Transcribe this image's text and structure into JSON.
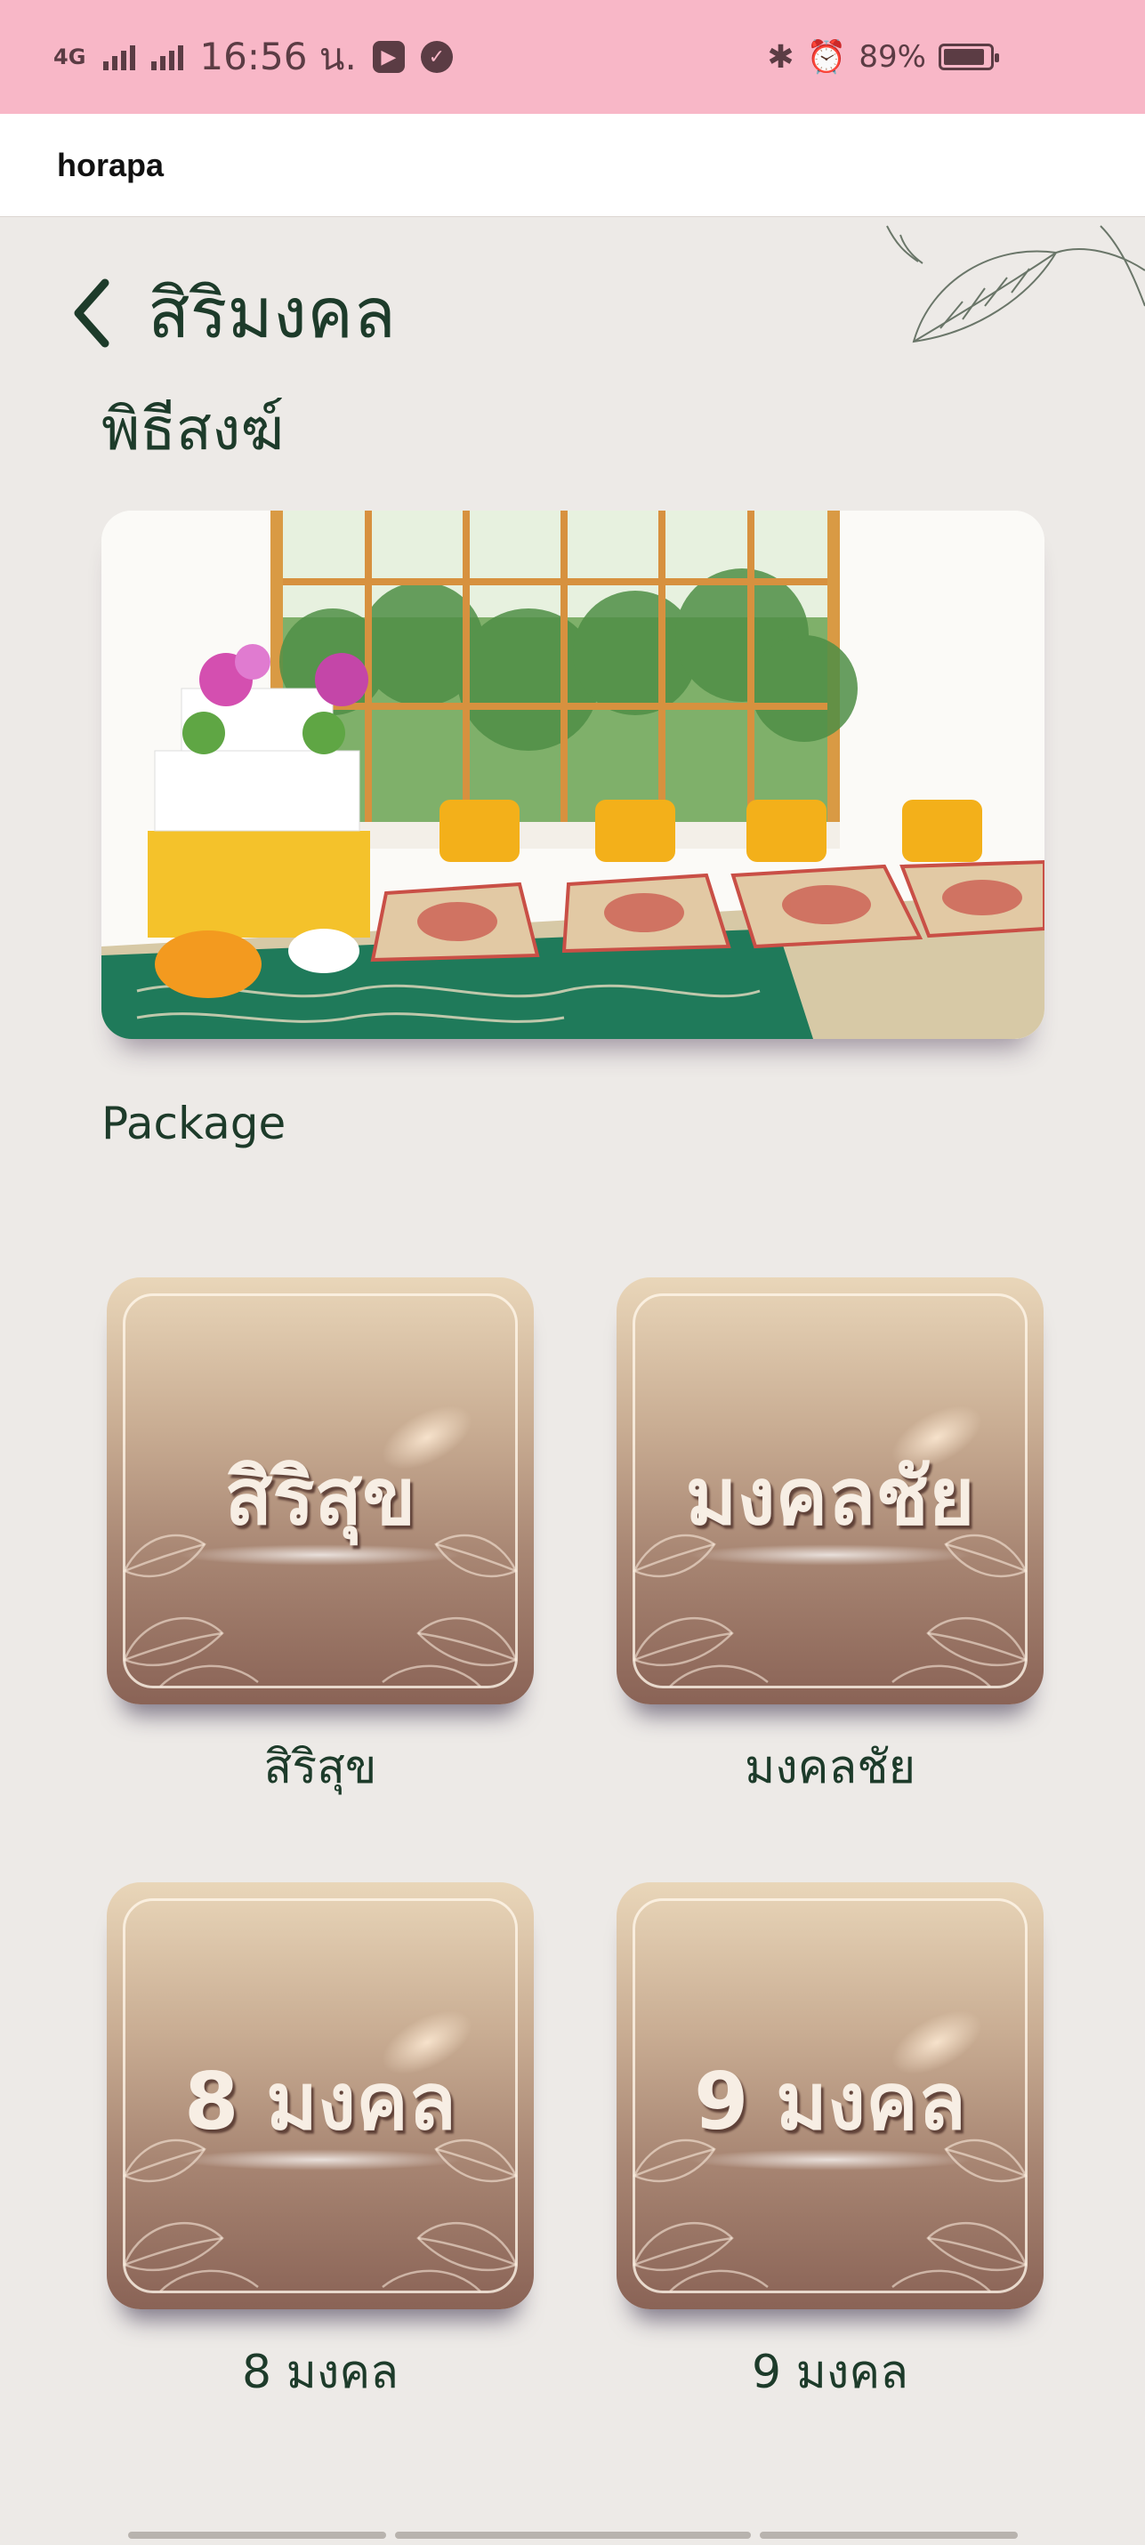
{
  "status_bar": {
    "network_left": "4G",
    "time": "16:56 น.",
    "battery": "89%",
    "battery_level": 0.89
  },
  "app_bar": {
    "title": "horapa"
  },
  "header": {
    "title": "สิริมงคล",
    "section": "พิธีสงฆ์"
  },
  "hero": {
    "icon": "ceremony-room-photo"
  },
  "package": {
    "label": "Package",
    "items": [
      {
        "tile_text": "สิริสุข",
        "caption": "สิริสุข"
      },
      {
        "tile_text": "มงคลชัย",
        "caption": "มงคลชัย"
      },
      {
        "tile_text": "8 มงคล",
        "caption": "8 มงคล"
      },
      {
        "tile_text": "9 มงคล",
        "caption": "9 มงคล"
      }
    ]
  },
  "colors": {
    "status_bar": "#f8b7c7",
    "background": "#edeae7",
    "title_text": "#1d3b2a",
    "tile_top": "#e9d6b9",
    "tile_bottom": "#8a6356"
  }
}
